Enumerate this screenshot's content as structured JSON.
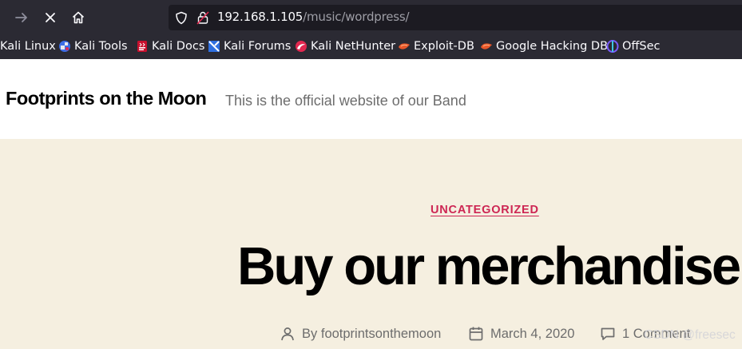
{
  "browser": {
    "url_host": "192.168.1.105",
    "url_path": "/music/wordpress/",
    "bookmarks": [
      {
        "label": "Kali Linux",
        "icon": "kali-linux-icon"
      },
      {
        "label": "Kali Tools",
        "icon": "kali-tools-icon"
      },
      {
        "label": "Kali Docs",
        "icon": "kali-docs-icon"
      },
      {
        "label": "Kali Forums",
        "icon": "kali-forums-icon"
      },
      {
        "label": "Kali NetHunter",
        "icon": "kali-nethunter-icon"
      },
      {
        "label": "Exploit-DB",
        "icon": "exploit-db-icon"
      },
      {
        "label": "Google Hacking DB",
        "icon": "google-hacking-db-icon"
      },
      {
        "label": "OffSec",
        "icon": "offsec-icon"
      }
    ]
  },
  "site": {
    "title": "Footprints on the Moon",
    "description": "This is the official website of our Band"
  },
  "post": {
    "category": "UNCATEGORIZED",
    "title": "Buy our merchandise",
    "author_prefix": "By",
    "author": "footprintsonthemoon",
    "date": "March 4, 2020",
    "comments": "1 Comment"
  },
  "watermark": "CSDN @freesec",
  "colors": {
    "accent": "#cd2653",
    "background": "#f5efe0",
    "browser_chrome": "#2b2a33"
  }
}
